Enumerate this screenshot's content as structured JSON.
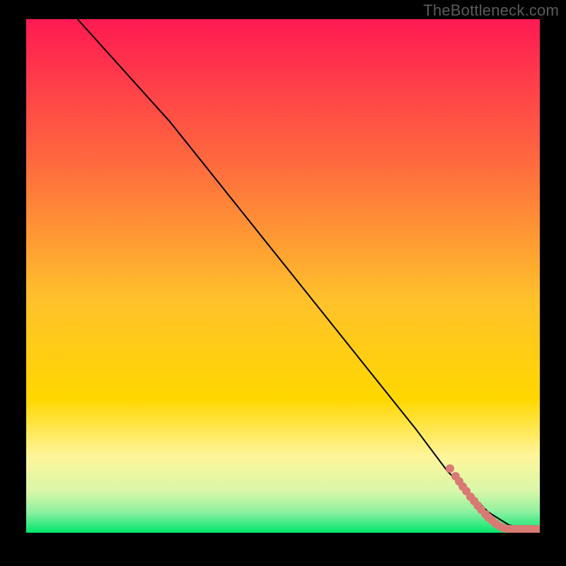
{
  "watermark": "TheBottleneck.com",
  "chart_data": {
    "type": "line",
    "title": "",
    "xlabel": "",
    "ylabel": "",
    "xlim": [
      0,
      100
    ],
    "ylim": [
      0,
      100
    ],
    "grid": false,
    "legend": false,
    "colors": {
      "gradient_top": "#ff1a52",
      "gradient_mid_upper": "#ff7a3a",
      "gradient_mid": "#ffd700",
      "gradient_lower": "#fff59a",
      "gradient_bottom": "#00e66b",
      "line": "#000000",
      "marker": "#d87a73"
    },
    "curve": {
      "name": "bottleneck-curve",
      "x": [
        10,
        28,
        40,
        52,
        64,
        76,
        82,
        86,
        90,
        94,
        98,
        100
      ],
      "y": [
        100,
        80,
        65,
        50,
        35,
        20,
        12,
        8,
        4,
        1.5,
        0.7,
        0.6
      ]
    },
    "markers": {
      "name": "data-points",
      "points": [
        {
          "x": 82.5,
          "y": 12.5
        },
        {
          "x": 83.6,
          "y": 11.0
        },
        {
          "x": 84.3,
          "y": 10.0
        },
        {
          "x": 85.0,
          "y": 9.0
        },
        {
          "x": 85.7,
          "y": 8.1
        },
        {
          "x": 86.5,
          "y": 7.0
        },
        {
          "x": 87.2,
          "y": 6.2
        },
        {
          "x": 87.9,
          "y": 5.3
        },
        {
          "x": 88.6,
          "y": 4.5
        },
        {
          "x": 89.4,
          "y": 3.6
        },
        {
          "x": 90.0,
          "y": 3.0
        },
        {
          "x": 90.8,
          "y": 2.3
        },
        {
          "x": 91.5,
          "y": 1.7
        },
        {
          "x": 92.3,
          "y": 1.2
        },
        {
          "x": 93.0,
          "y": 0.9
        },
        {
          "x": 94.0,
          "y": 0.7
        },
        {
          "x": 94.7,
          "y": 0.7
        },
        {
          "x": 95.2,
          "y": 0.7
        },
        {
          "x": 96.0,
          "y": 0.7
        },
        {
          "x": 96.6,
          "y": 0.7
        },
        {
          "x": 97.3,
          "y": 0.7
        },
        {
          "x": 98.0,
          "y": 0.7
        },
        {
          "x": 98.7,
          "y": 0.7
        },
        {
          "x": 99.7,
          "y": 0.7
        },
        {
          "x": 100.3,
          "y": 0.7
        }
      ]
    }
  }
}
